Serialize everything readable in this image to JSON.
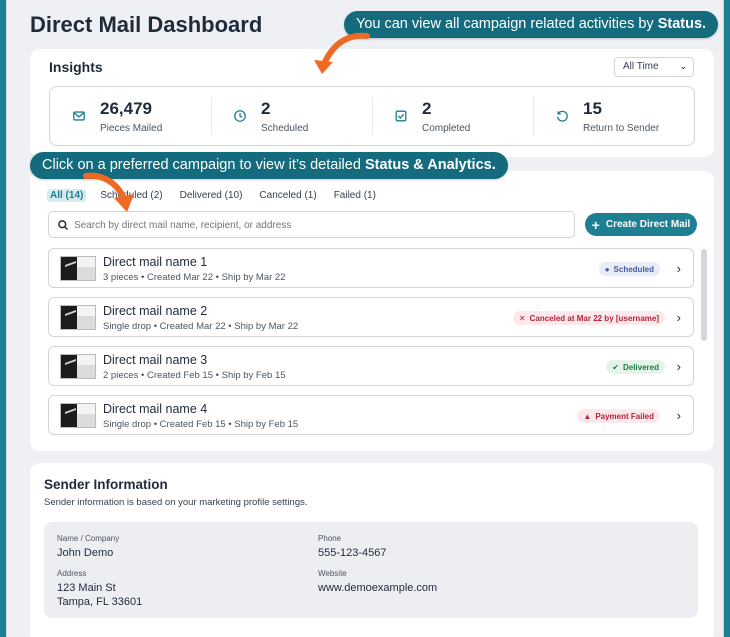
{
  "page": {
    "title": "Direct Mail Dashboard"
  },
  "callouts": {
    "status_prefix": "You can view all campaign related activities by ",
    "status_bold": "Status.",
    "campaign_prefix": "Click on a preferred campaign to view it’s detailed ",
    "campaign_bold": "Status & Analytics."
  },
  "insights": {
    "title": "Insights",
    "time_filter": "All Time",
    "stats": [
      {
        "value": "26,479",
        "label": "Pieces Mailed",
        "icon": "mail-icon"
      },
      {
        "value": "2",
        "label": "Scheduled",
        "icon": "clock-icon"
      },
      {
        "value": "2",
        "label": "Completed",
        "icon": "checkbox-icon"
      },
      {
        "value": "15",
        "label": "Return to Sender",
        "icon": "return-icon"
      }
    ]
  },
  "filters": {
    "tabs": [
      "All (14)",
      "Scheduled (2)",
      "Delivered (10)",
      "Canceled (1)",
      "Failed (1)"
    ],
    "active_tab": "All (14)"
  },
  "search": {
    "placeholder": "Search by direct mail name, recipient, or address"
  },
  "create_button": {
    "label": "Create Direct Mail"
  },
  "mails": [
    {
      "name": "Direct mail name 1",
      "meta": "3 pieces • Created Mar 22 • Ship by Mar 22",
      "status": "Scheduled",
      "status_icon": "clock-icon"
    },
    {
      "name": "Direct mail name 2",
      "meta": "Single drop • Created Mar 22 • Ship by Mar 22",
      "status": "Canceled at Mar 22 by [username]",
      "status_icon": "x-icon"
    },
    {
      "name": "Direct mail name 3",
      "meta": "2 pieces • Created Feb 15 • Ship by Feb 15",
      "status": "Delivered",
      "status_icon": "check-circle-icon"
    },
    {
      "name": "Direct mail name 4",
      "meta": "Single drop • Created Feb 15 • Ship by Feb 15",
      "status": "Payment Failed",
      "status_icon": "warning-icon"
    }
  ],
  "sender": {
    "title": "Sender Information",
    "subtitle": "Sender information is based on your marketing profile settings.",
    "name_label": "Name / Company",
    "name": "John Demo",
    "phone_label": "Phone",
    "phone": "555-123-4567",
    "address_label": "Address",
    "address_line1": "123 Main St",
    "address_line2": "Tampa, FL 33601",
    "website_label": "Website",
    "website": "www.demoexample.com"
  },
  "colors": {
    "brand": "#1e7f92",
    "callout": "#136b7d",
    "arrow": "#ee6a24"
  }
}
